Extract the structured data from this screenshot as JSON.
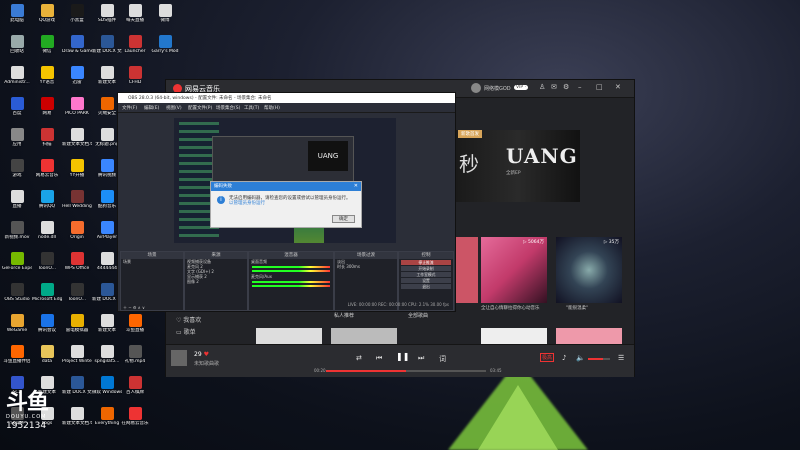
{
  "desktop_icons": [
    {
      "label": "此电脑",
      "color": "#3a7bd5"
    },
    {
      "label": "QQ游戏",
      "color": "#e9b23a"
    },
    {
      "label": "小黑盒",
      "color": "#1a1a1a"
    },
    {
      "label": "SDS插件",
      "color": "#ddd"
    },
    {
      "label": "每天直播",
      "color": "#ddd"
    },
    {
      "label": "微博",
      "color": "#ddd"
    },
    {
      "label": "回收站",
      "color": "#9aa"
    },
    {
      "label": "微信",
      "color": "#2a2"
    },
    {
      "label": "Draw & Game",
      "color": "#36c"
    },
    {
      "label": "新建 DOCX 文档.docx",
      "color": "#2b5797"
    },
    {
      "label": "Launcher",
      "color": "#c33"
    },
    {
      "label": "Garry's Mod",
      "color": "#27c"
    },
    {
      "label": "Administr...",
      "color": "#ddd"
    },
    {
      "label": "YY语音",
      "color": "#f5c400"
    },
    {
      "label": "迅雷",
      "color": "#3a86ff"
    },
    {
      "label": "新建文本",
      "color": "#ddd"
    },
    {
      "label": "CFHD",
      "color": "#c33"
    },
    {
      "label": "百度",
      "color": "#2a5cd6"
    },
    {
      "label": "网易",
      "color": "#c00"
    },
    {
      "label": "PICO PARK",
      "color": "#f7c"
    },
    {
      "label": "火绒安全",
      "color": "#e60"
    },
    {
      "label": "应用",
      "color": "#888"
    },
    {
      "label": "扫描",
      "color": "#c33"
    },
    {
      "label": "新建文本文档.txt",
      "color": "#ddd"
    },
    {
      "label": "无标题.png",
      "color": "#ddd"
    },
    {
      "label": "游戏",
      "color": "#444"
    },
    {
      "label": "网易云音乐",
      "color": "#e33"
    },
    {
      "label": "YY开播",
      "color": "#f5c400"
    },
    {
      "label": "腾讯视频",
      "color": "#3a86ff"
    },
    {
      "label": "直播",
      "color": "#ddd"
    },
    {
      "label": "腾讯QQ",
      "color": "#1aa3e8"
    },
    {
      "label": "Hell Wedding",
      "color": "#733"
    },
    {
      "label": "酷狗音乐",
      "color": "#1c8ef7"
    },
    {
      "label": "新视频.mov",
      "color": "#555"
    },
    {
      "label": "node.dll",
      "color": "#ddd"
    },
    {
      "label": "Origin",
      "color": "#f56c2d"
    },
    {
      "label": "AirPlayer",
      "color": "#3a86ff"
    },
    {
      "label": "GeForce Experience",
      "color": "#76b900"
    },
    {
      "label": "ToonO...",
      "color": "#333"
    },
    {
      "label": "WPS Office",
      "color": "#d33"
    },
    {
      "label": "4444444",
      "color": "#ddd"
    },
    {
      "label": "OBS Studio",
      "color": "#333"
    },
    {
      "label": "Microsoft Edge",
      "color": "#0a8"
    },
    {
      "label": "ToonO...",
      "color": "#333"
    },
    {
      "label": "新建 DOCX 文档.docx",
      "color": "#2b5797"
    },
    {
      "label": "WeGame",
      "color": "#e8a530"
    },
    {
      "label": "腾讯会议",
      "color": "#1a73e8"
    },
    {
      "label": "雷电模拟器",
      "color": "#e8b000"
    },
    {
      "label": "新建文本",
      "color": "#ddd"
    },
    {
      "label": "斗鱼直播",
      "color": "#f60"
    },
    {
      "label": "斗鱼直播伴侣",
      "color": "#f60"
    },
    {
      "label": "data",
      "color": "#e8c55a"
    },
    {
      "label": "Project Winter",
      "color": "#ddd"
    },
    {
      "label": "spngilaf5...",
      "color": "#ddd"
    },
    {
      "label": "礼物.mp4",
      "color": "#555"
    },
    {
      "label": "SC2",
      "color": "#35c"
    },
    {
      "label": "新建文本",
      "color": "#ddd"
    },
    {
      "label": "新建 DOCX 文档.docx",
      "color": "#2b5797"
    },
    {
      "label": "微软 Windows...",
      "color": "#0078d4"
    },
    {
      "label": "百人棋牌",
      "color": "#c33"
    },
    {
      "label": "SCUM",
      "color": "#555"
    },
    {
      "label": "Logs",
      "color": "#ddd"
    },
    {
      "label": "新建文本文档.txt",
      "color": "#ddd"
    },
    {
      "label": "Everything",
      "color": "#e60"
    },
    {
      "label": "在网易云音乐",
      "color": "#e33"
    }
  ],
  "watermark": {
    "logo": "斗鱼",
    "sub": "DOUYU.COM",
    "room": "1952134"
  },
  "music": {
    "app_name": "网易云音乐",
    "user": "网络模GOD",
    "vip": "VIP ·",
    "banner": {
      "tag": "新歌首发",
      "title": "UANG",
      "side": "秒",
      "sub": "全新EP"
    },
    "cards": [
      {
        "count": "▷ 5064万",
        "label": "全让自心情聊拉得你心动音乐"
      },
      {
        "count": "▷ 35万",
        "label": "\"能很温柔\""
      }
    ],
    "nav": "歌单",
    "nav2": "我喜欢",
    "sections": [
      "私人推荐",
      "全部歌曲"
    ],
    "player": {
      "song": "29",
      "artist": "未知歌曲歌",
      "time_now": "00:20",
      "time_end": "03:45",
      "lyric": "词",
      "quality": "极高"
    }
  },
  "obs": {
    "title": "OBS 28.0.3 (64-bit, windows) - 配置文件: 未命名 - 场景集合: 未命名",
    "menu": [
      "文件(F)",
      "编辑(E)",
      "视图(V)",
      "配置文件(P)",
      "场景集合(S)",
      "工具(T)",
      "帮助(H)"
    ],
    "dialog": {
      "title": "编码失败",
      "message": "无法启用编码器，请检查您的设置或尝试以管理员身份运行。",
      "link": "以管理员身份运行",
      "ok": "确定"
    },
    "docks": {
      "scenes": "场景",
      "sources": "来源",
      "mixer": "混音器",
      "transitions": "场景过渡",
      "controls": "控制"
    },
    "scene_items": [
      "场景"
    ],
    "source_items": [
      "视频捕获设备",
      "麦克风 2",
      "文字 (GDI+) 2",
      "显示捕获 2",
      "图像 2"
    ],
    "mixer_items": [
      "桌面音频",
      "麦克风/Aux"
    ],
    "transition": "淡出",
    "duration": "300ms",
    "duration_label": "时长",
    "controls": [
      "停止推流",
      "开始录制",
      "工作室模式",
      "设置",
      "退出"
    ],
    "status": "LIVE: 00:00:00   REC: 00:00:00   CPU: 2.1%  30.00 fps"
  }
}
